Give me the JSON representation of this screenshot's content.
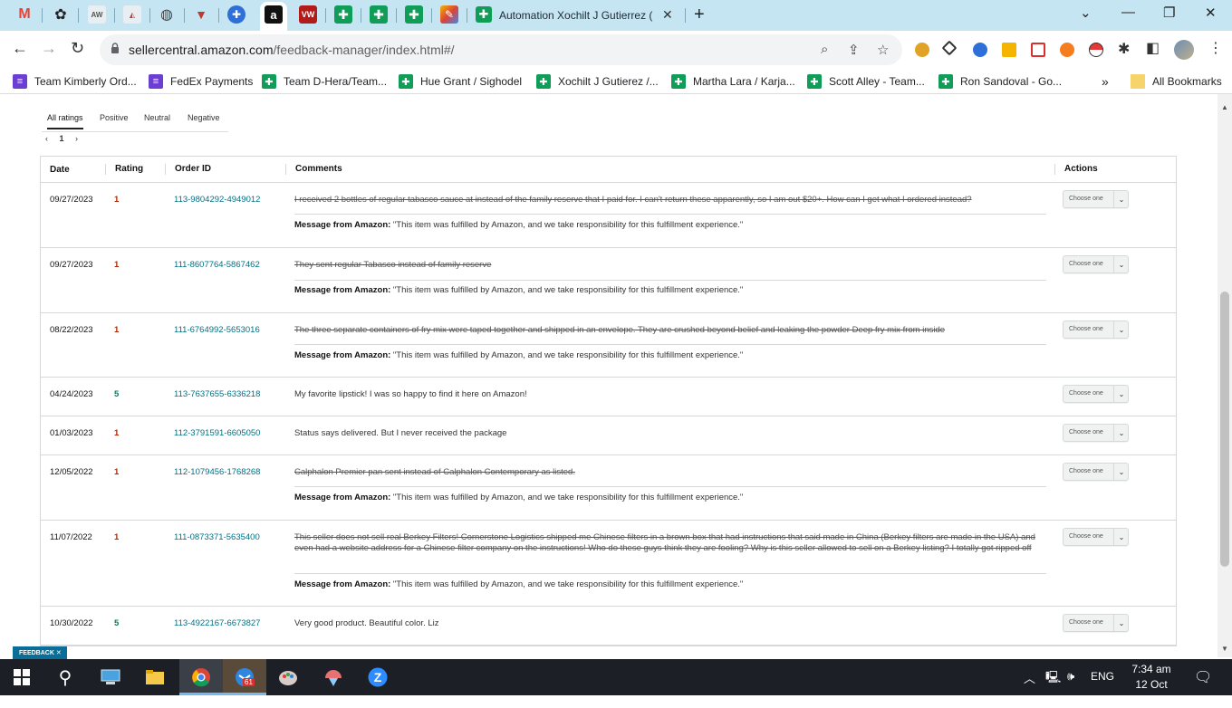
{
  "browser": {
    "active_tab_title": "Automation Xochilt J Gutierrez (",
    "url_host": "sellercentral.amazon.com",
    "url_path": "/feedback-manager/index.html#/"
  },
  "bookmarks": [
    {
      "label": "Team Kimberly Ord...",
      "color": "#6a3fd1",
      "icon": "list-icon"
    },
    {
      "label": "FedEx Payments",
      "color": "#6a3fd1",
      "icon": "list-icon"
    },
    {
      "label": "Team D-Hera/Team...",
      "color": "#0f9d58",
      "icon": "sheets-icon"
    },
    {
      "label": "Hue Grant / Sighodel",
      "color": "#0f9d58",
      "icon": "sheets-icon"
    },
    {
      "label": "Xochilt J Gutierez /...",
      "color": "#0f9d58",
      "icon": "sheets-icon"
    },
    {
      "label": "Martha Lara / Karja...",
      "color": "#0f9d58",
      "icon": "sheets-icon"
    },
    {
      "label": "Scott Alley - Team...",
      "color": "#0f9d58",
      "icon": "sheets-icon"
    },
    {
      "label": "Ron Sandoval - Go...",
      "color": "#0f9d58",
      "icon": "sheets-icon"
    }
  ],
  "all_bookmarks_label": "All Bookmarks",
  "filters": {
    "all": "All ratings",
    "positive": "Positive",
    "neutral": "Neutral",
    "negative": "Negative",
    "page": "1"
  },
  "table": {
    "headers": {
      "date": "Date",
      "rating": "Rating",
      "order": "Order ID",
      "comments": "Comments",
      "actions": "Actions"
    },
    "message_label": "Message from Amazon:",
    "message_text": "\"This item was fulfilled by Amazon, and we take responsibility for this fulfillment experience.\"",
    "action_label": "Choose one",
    "rows": [
      {
        "date": "09/27/2023",
        "rating": "1",
        "order": "113-9804292-4949012",
        "comment": "I received 2 bottles of regular tabasco sauce at instead of the family reserve that I paid for. I can't return these apparently, so I am out $20+. How can I get what I ordered instead?"
      },
      {
        "date": "09/27/2023",
        "rating": "1",
        "order": "111-8607764-5867462",
        "comment": "They sent regular Tabasco instead of family reserve"
      },
      {
        "date": "08/22/2023",
        "rating": "1",
        "order": "111-6764992-5653016",
        "comment": "The three separate containers of fry mix were taped together and shipped in an envelope. They are crushed beyond belief and leaking the powder Deep fry mix from inside"
      },
      {
        "date": "04/24/2023",
        "rating": "5",
        "order": "113-7637655-6336218",
        "comment": "My favorite lipstick! I was so happy to find it here on Amazon!"
      },
      {
        "date": "01/03/2023",
        "rating": "1",
        "order": "112-3791591-6605050",
        "comment": "Status says delivered. But I never received the package"
      },
      {
        "date": "12/05/2022",
        "rating": "1",
        "order": "112-1079456-1768268",
        "comment": "Calphalon Premier pan sent instead of Calphalon Contemporary as listed."
      },
      {
        "date": "11/07/2022",
        "rating": "1",
        "order": "111-0873371-5635400",
        "comment": "This seller does not sell real Berkey Filters! Cornerstone Logistics shipped me Chinese filters in a brown box that had instructions that said made in China (Berkey filters are made in the USA) and even had a website address for a Chinese filter company on the instructions! Who do these guys think they are fooling? Why is this seller allowed to sell on a Berkey listing? I totally got ripped off"
      },
      {
        "date": "10/30/2022",
        "rating": "5",
        "order": "113-4922167-6673827",
        "comment": "Very good product. Beautiful color. Liz"
      }
    ]
  },
  "feedback_tag": "FEEDBACK ✕",
  "taskbar": {
    "badge": "61",
    "lang": "ENG",
    "time": "7:34 am",
    "date": "12 Oct 2023"
  }
}
